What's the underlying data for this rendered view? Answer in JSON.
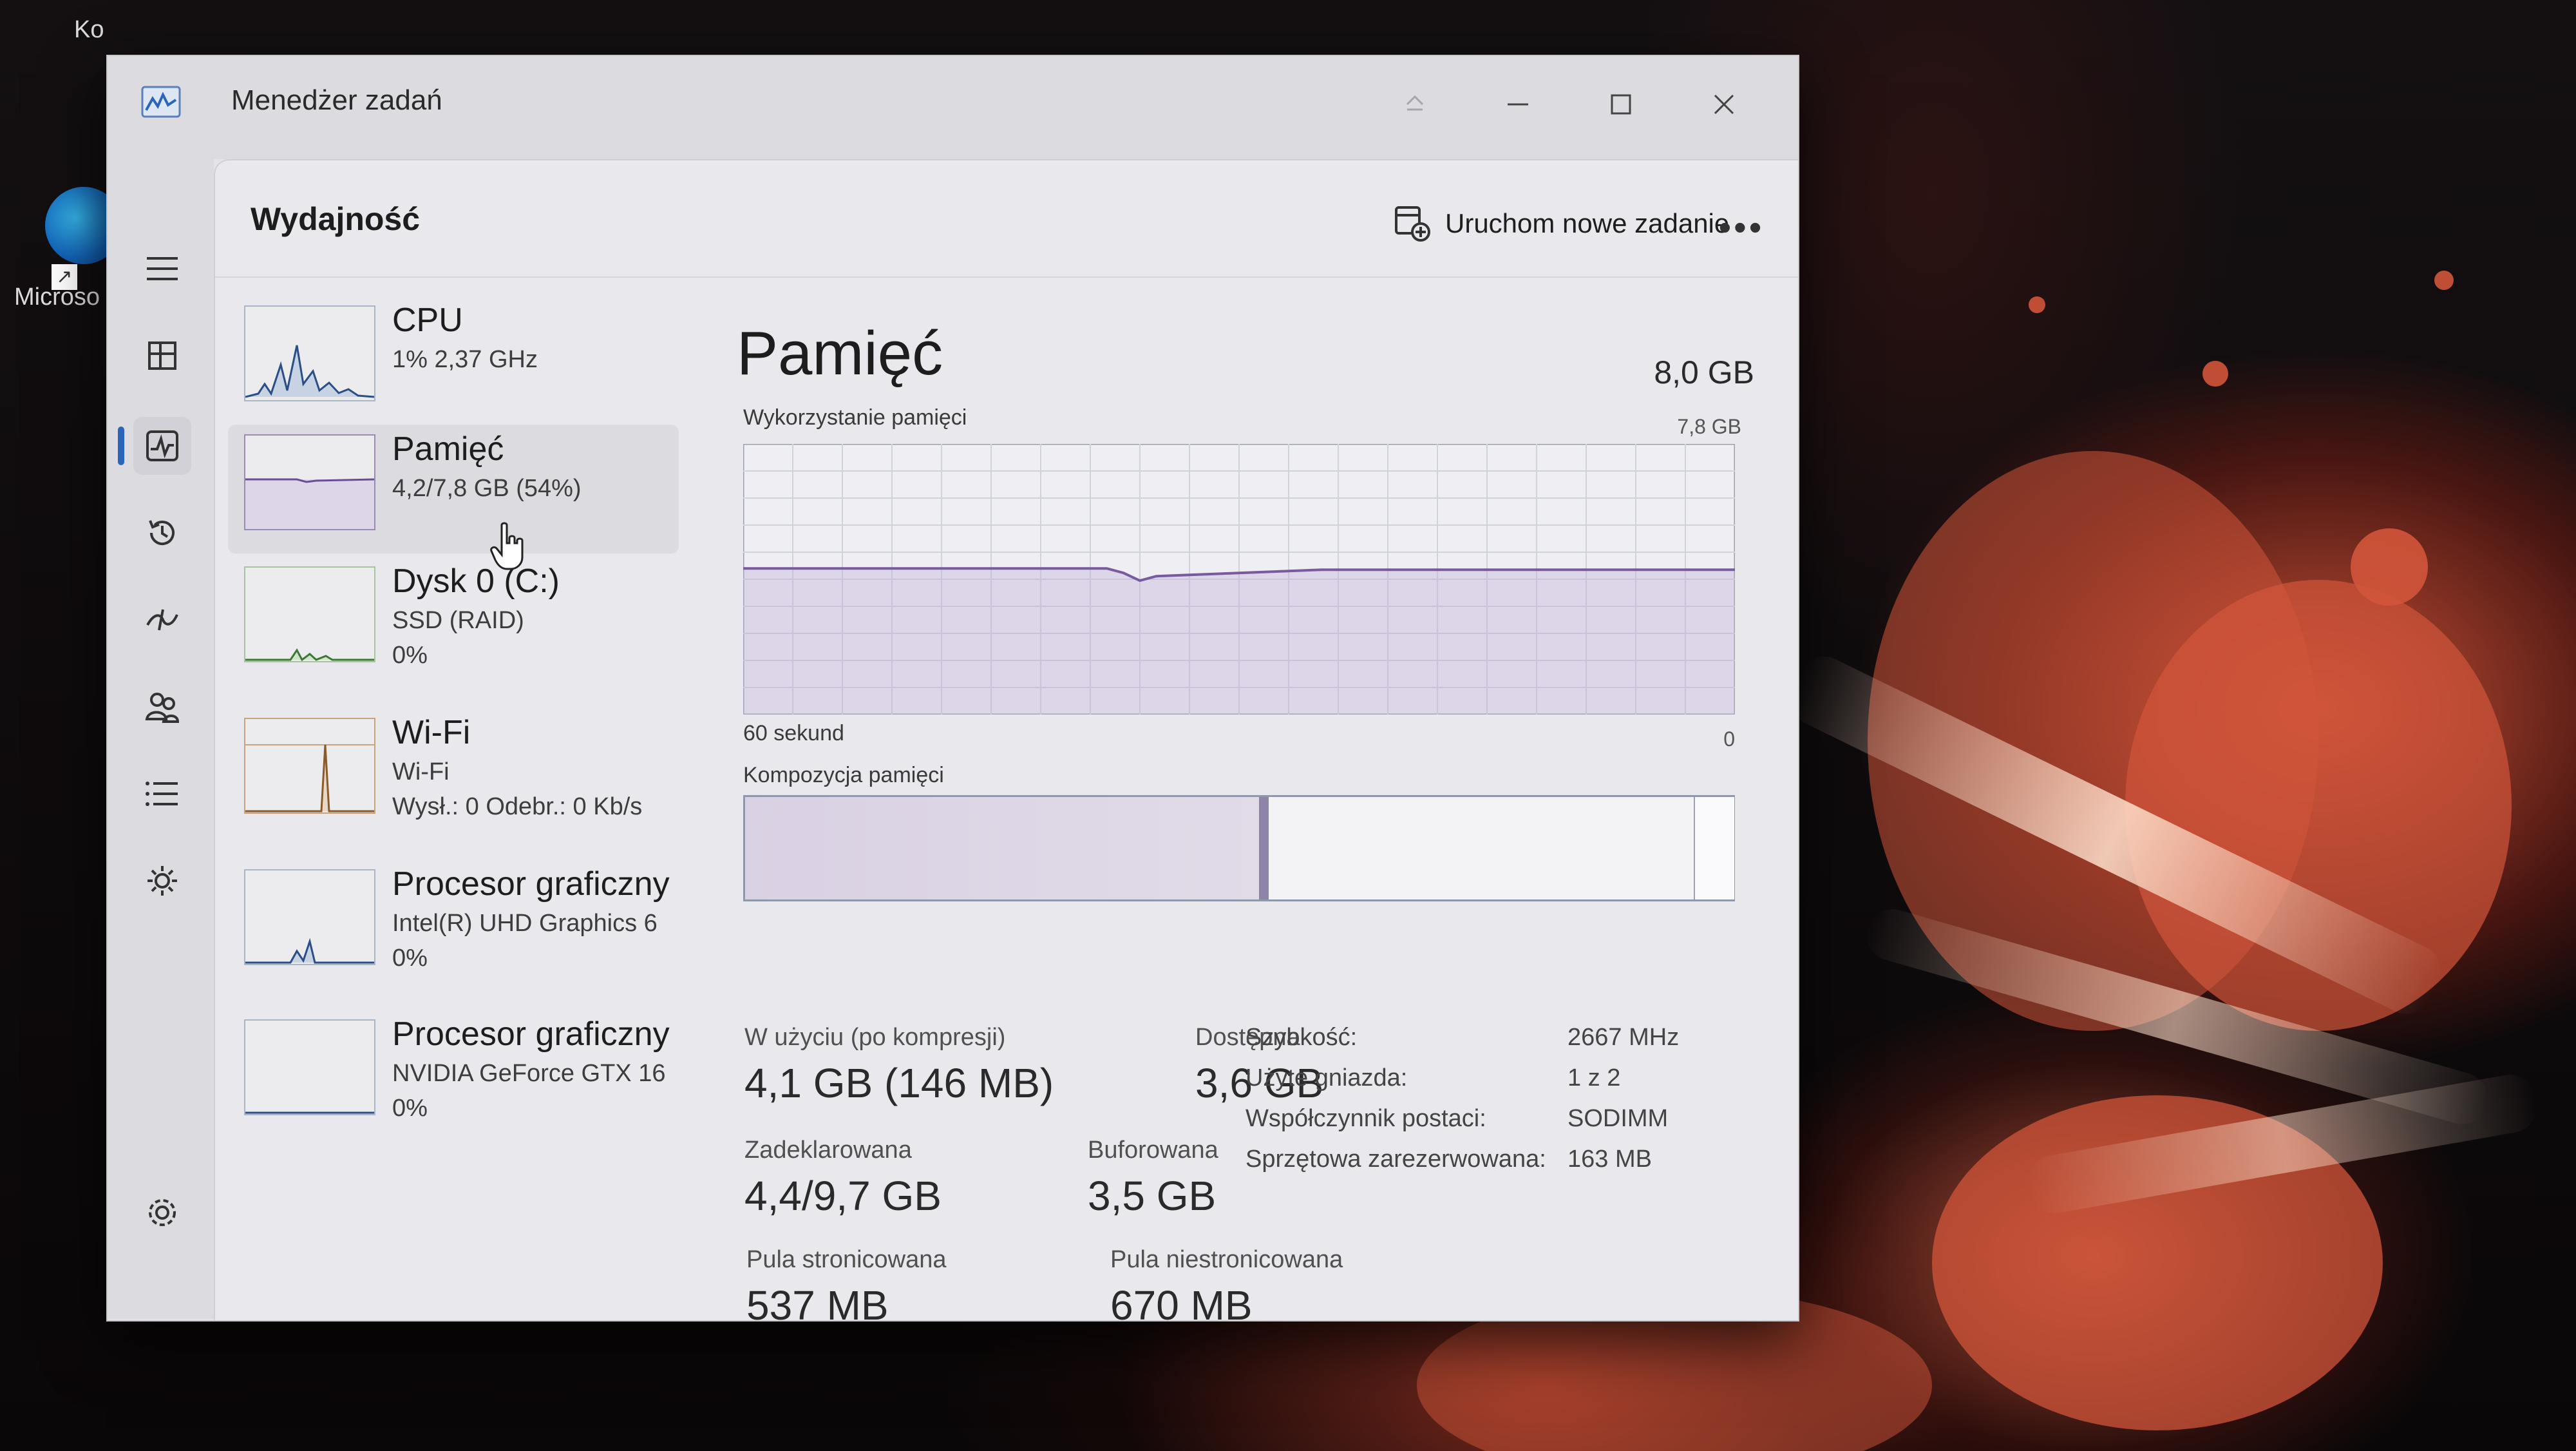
{
  "desktop": {
    "icon_top_label": "Ko",
    "icon_label": "Microso"
  },
  "window": {
    "title": "Menedżer zadań"
  },
  "header": {
    "page_title": "Wydajność",
    "run_task_label": "Uruchom nowe zadanie",
    "more_label": "•••"
  },
  "devices": [
    {
      "title": "CPU",
      "line1": "1% 2,37 GHz",
      "line2": ""
    },
    {
      "title": "Pamięć",
      "line1": "4,2/7,8 GB (54%)",
      "line2": ""
    },
    {
      "title": "Dysk 0 (C:)",
      "line1": "SSD (RAID)",
      "line2": "0%"
    },
    {
      "title": "Wi-Fi",
      "line1": "Wi-Fi",
      "line2": "Wysł.: 0 Odebr.: 0 Kb/s"
    },
    {
      "title": "Procesor graficzny",
      "line1": "Intel(R) UHD Graphics 6",
      "line2": "0%"
    },
    {
      "title": "Procesor graficzny",
      "line1": "NVIDIA GeForce GTX 16",
      "line2": "0%"
    }
  ],
  "detail": {
    "title": "Pamięć",
    "total": "8,0 GB",
    "graph_label": "Wykorzystanie pamięci",
    "graph_max": "7,8 GB",
    "axis_left": "60 sekund",
    "axis_right": "0",
    "composition_label": "Kompozycja pamięci",
    "composition": {
      "in_use_fraction": 0.52,
      "modified_fraction": 0.01,
      "standby_fraction": 0.43,
      "free_fraction": 0.04
    },
    "usage_fraction": 0.54,
    "stats": {
      "in_use_label": "W użyciu (po kompresji)",
      "in_use_value": "4,1 GB (146 MB)",
      "available_label": "Dostępna",
      "available_value": "3,6 GB",
      "committed_label": "Zadeklarowana",
      "committed_value": "4,4/9,7 GB",
      "cached_label": "Buforowana",
      "cached_value": "3,5 GB",
      "paged_label": "Pula stronicowana",
      "paged_value": "537 MB",
      "nonpaged_label": "Pula niestronicowana",
      "nonpaged_value": "670 MB"
    },
    "specs": [
      {
        "key": "Szybkość:",
        "value": "2667 MHz"
      },
      {
        "key": "Użyte gniazda:",
        "value": "1 z 2"
      },
      {
        "key": "Współczynnik postaci:",
        "value": "SODIMM"
      },
      {
        "key": "Sprzętowa zarezerwowana:",
        "value": "163 MB"
      }
    ]
  },
  "colors": {
    "accent": "#2a65b8",
    "memory_line": "#7a5a9e",
    "grid": "#cfd3dc"
  }
}
